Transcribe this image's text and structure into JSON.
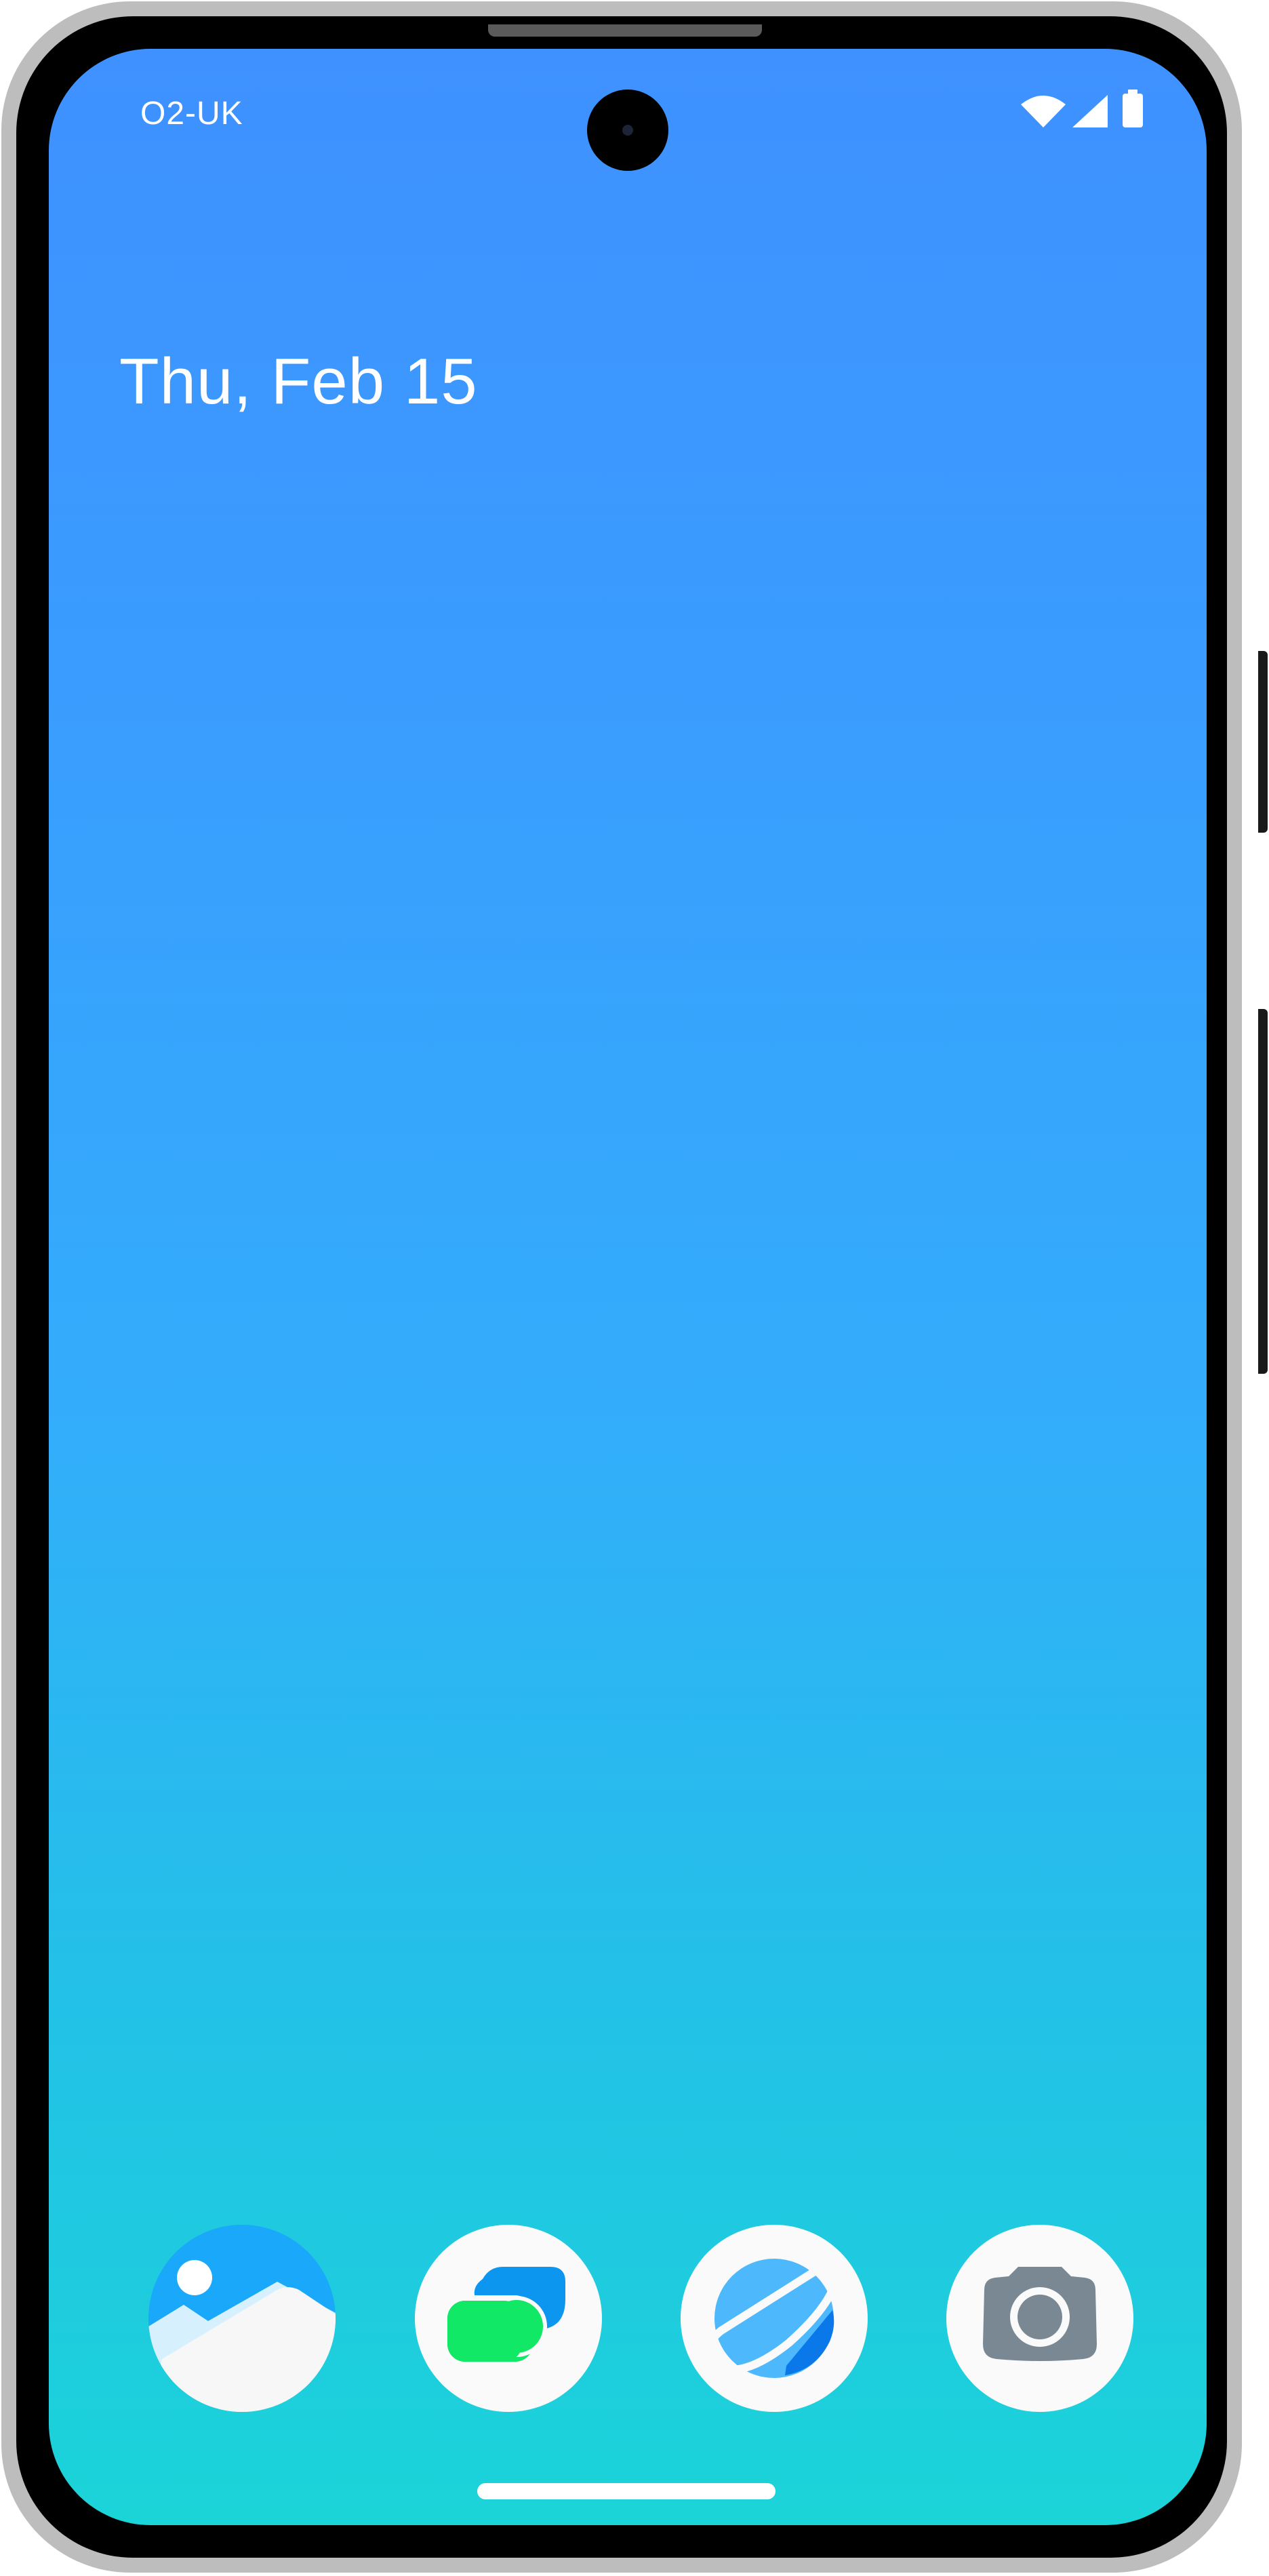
{
  "status_bar": {
    "carrier": "O2-UK",
    "icons": [
      "wifi-icon",
      "cellular-signal-icon",
      "battery-icon"
    ]
  },
  "home": {
    "date": "Thu, Feb 15"
  },
  "dock": {
    "apps": [
      {
        "icon": "gallery-icon"
      },
      {
        "icon": "messages-icon"
      },
      {
        "icon": "browser-icon"
      },
      {
        "icon": "camera-icon"
      }
    ]
  },
  "colors": {
    "wallpaper_top": "#3f91ff",
    "wallpaper_bottom": "#1bd4d8",
    "frame": "#bdbdbd",
    "bezel": "#000000"
  }
}
